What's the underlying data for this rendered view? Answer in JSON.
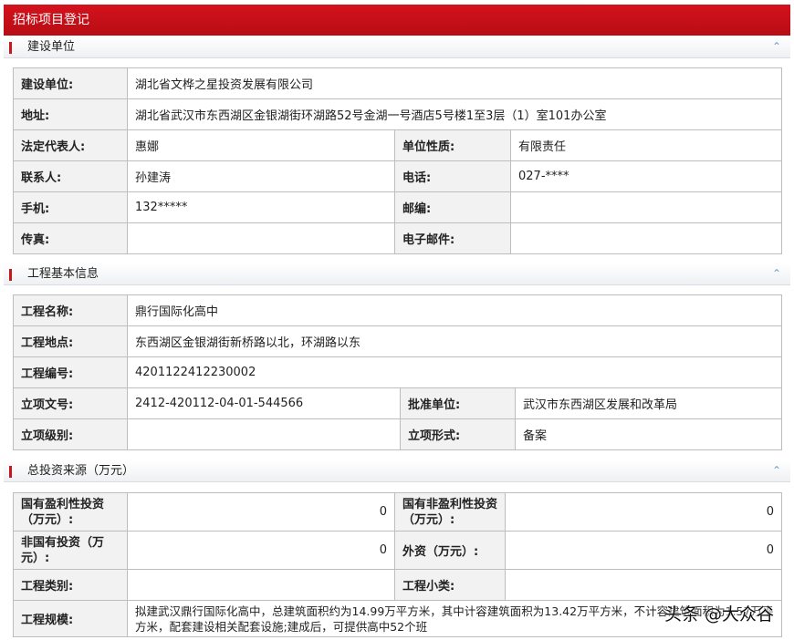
{
  "page_title": "招标项目登记",
  "sections": {
    "builder": {
      "title": "建设单位"
    },
    "project": {
      "title": "工程基本信息"
    },
    "investment": {
      "title": "总投资来源（万元）"
    }
  },
  "builder": {
    "unit_label": "建设单位:",
    "unit_value": "湖北省文桦之星投资发展有限公司",
    "address_label": "地址:",
    "address_value": "湖北省武汉市东西湖区金银湖街环湖路52号金湖一号酒店5号楼1至3层（1）室101办公室",
    "legal_rep_label": "法定代表人:",
    "legal_rep_value": "惠娜",
    "unit_nature_label": "单位性质:",
    "unit_nature_value": "有限责任",
    "contact_label": "联系人:",
    "contact_value": "孙建涛",
    "phone_label": "电话:",
    "phone_value": "027-****",
    "mobile_label": "手机:",
    "mobile_value": "132*****",
    "postcode_label": "邮编:",
    "postcode_value": "",
    "fax_label": "传真:",
    "fax_value": "",
    "email_label": "电子邮件:",
    "email_value": ""
  },
  "project": {
    "name_label": "工程名称:",
    "name_value": "鼎行国际化高中",
    "location_label": "工程地点:",
    "location_value": "东西湖区金银湖街新桥路以北，环湖路以东",
    "code_label": "工程编号:",
    "code_value": "4201122412230002",
    "approval_doc_label": "立项文号:",
    "approval_doc_value": "2412-420112-04-01-544566",
    "approval_unit_label": "批准单位:",
    "approval_unit_value": "武汉市东西湖区发展和改革局",
    "approval_level_label": "立项级别:",
    "approval_level_value": "",
    "approval_form_label": "立项形式:",
    "approval_form_value": "备案"
  },
  "investment": {
    "state_profit_label": "国有盈利性投资（万元）:",
    "state_profit_value": "0",
    "state_nonprofit_label": "国有非盈利性投资（万元）:",
    "state_nonprofit_value": "0",
    "non_state_label": "非国有投资（万元）:",
    "non_state_value": "0",
    "foreign_label": "外资（万元）:",
    "foreign_value": "0",
    "category_label": "工程类别:",
    "category_value": "",
    "subcategory_label": "工程小类:",
    "subcategory_value": "",
    "scale_label": "工程规模:",
    "scale_value": "拟建武汉鼎行国际化高中，总建筑面积约为14.99万平方米，其中计容建筑面积为13.42万平方米，不计容建筑面积为1.57万平方米，配套建设相关配套设施;建成后，可提供高中52个班"
  },
  "watermark": "头条 @大众谷",
  "icons": {
    "collapse": "double-chevron-up-icon"
  },
  "colors": {
    "header_red": "#c8161d",
    "label_bg": "#f2f2f2",
    "border": "#bdbdbd",
    "collapse_blue": "#6a9fd0"
  }
}
